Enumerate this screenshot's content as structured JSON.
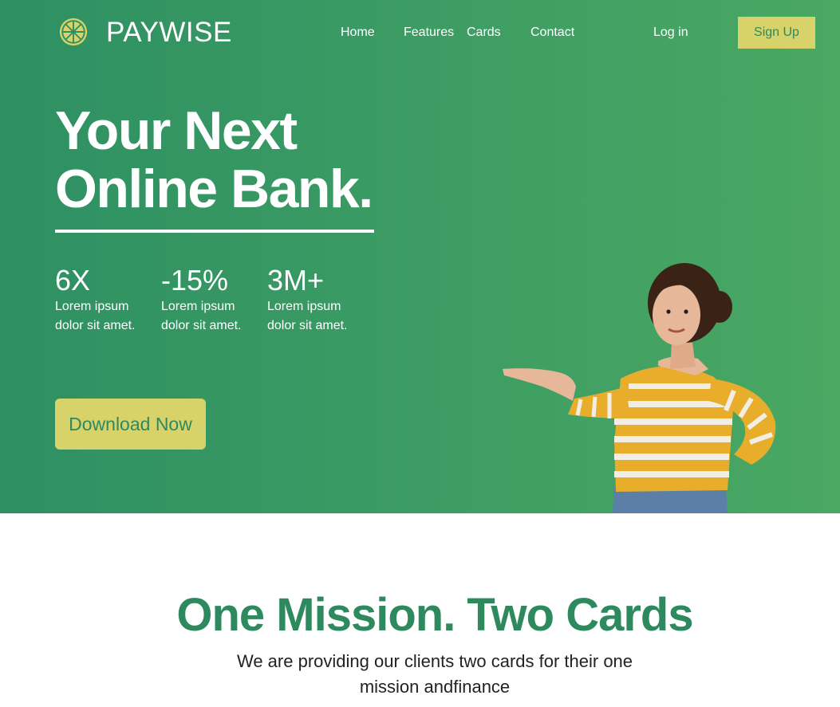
{
  "brand": {
    "name": "PAYWISE",
    "logo_icon": "lemon-slice-icon",
    "colors": {
      "primary_green": "#2e8a5e",
      "accent_yellow": "#d8d26a"
    }
  },
  "nav": {
    "links": [
      "Home",
      "Features",
      "Cards",
      "Contact"
    ],
    "login": "Log in",
    "signup": "Sign Up"
  },
  "hero": {
    "headline_line1": "Your Next",
    "headline_line2": "Online Bank.",
    "stats": [
      {
        "value": "6X",
        "line1": "Lorem ipsum",
        "line2": "dolor sit amet."
      },
      {
        "value": "-15%",
        "line1": "Lorem ipsum",
        "line2": "dolor sit amet."
      },
      {
        "value": "3M+",
        "line1": "Lorem ipsum",
        "line2": "dolor sit amet."
      }
    ],
    "cta": "Download Now"
  },
  "mission": {
    "title": "One Mission. Two Cards",
    "subtitle_line1": "We are providing our clients two cards for their one",
    "subtitle_line2": "mission andfinance"
  }
}
